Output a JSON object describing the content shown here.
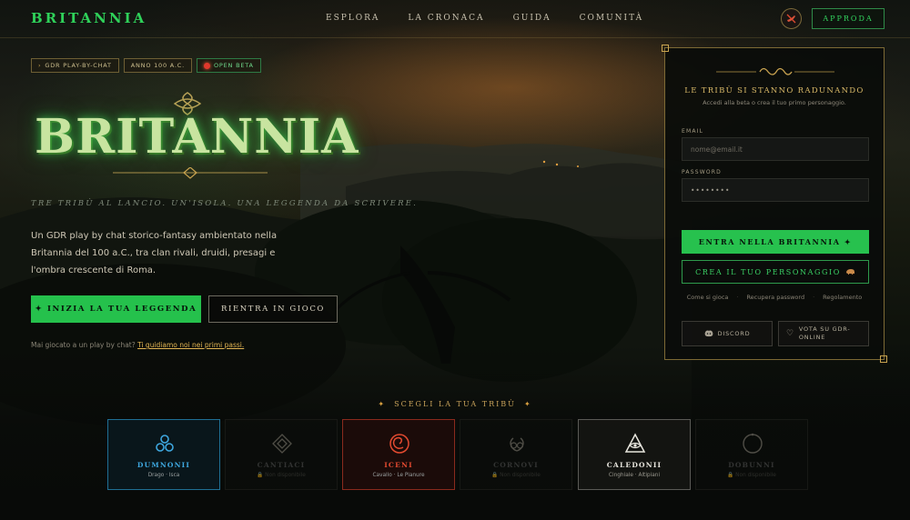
{
  "nav": {
    "brand": "BRITANNIA",
    "links": [
      "ESPLORA",
      "LA CRONACA",
      "GUIDA",
      "COMUNITÀ"
    ],
    "sound_icon": "muted-horn-icon",
    "login_label": "APPRODA"
  },
  "hero": {
    "badges": [
      "GDR PLAY-BY-CHAT",
      "ANNO 100 A.C.",
      "OPEN BETA"
    ],
    "logo_text": "BRITANNIA",
    "tagline": "TRE TRIBÙ AL LANCIO. UN'ISOLA. UNA LEGGENDA DA SCRIVERE.",
    "description": "Un GDR play by chat storico-fantasy ambientato nella Britannia del 100 a.C., tra clan rivali, druidi, presagi e l'ombra crescente di Roma.",
    "cta_primary": "✦ INIZIA LA TUA LEGGENDA",
    "cta_secondary": "RIENTRA IN GIOCO",
    "help_text": "Mai giocato a un play by chat?",
    "help_link": "Ti guidiamo noi nei primi passi."
  },
  "panel": {
    "title": "LE TRIBÙ SI STANNO RADUNANDO",
    "subtitle": "Accedi alla beta o crea il tuo primo personaggio.",
    "email_label": "EMAIL",
    "email_placeholder": "nome@email.it",
    "password_label": "PASSWORD",
    "password_value": "••••••••",
    "enter_label": "ENTRA NELLA BRITANNIA ✦",
    "create_label": "CREA IL TUO PERSONAGGIO",
    "links": [
      "Come si gioca",
      "Recupera password",
      "Regolamento"
    ],
    "discord_label": "DISCORD",
    "vote_label": "VOTA SU GDR-ONLINE"
  },
  "tribes": {
    "title": "SCEGLI LA TUA TRIBÙ",
    "items": [
      {
        "name": "DUMNONII",
        "sub": "Drago · Isca",
        "icon": "triskelion-icon",
        "state": "active-blue"
      },
      {
        "name": "CANTIACI",
        "sub": "🔒 Non disponibile",
        "icon": "diamond-knot-icon",
        "state": "locked"
      },
      {
        "name": "ICENI",
        "sub": "Cavallo · Le Pianure",
        "icon": "spiral-icon",
        "state": "active-red"
      },
      {
        "name": "CORNOVI",
        "sub": "🔒 Non disponibile",
        "icon": "antlers-icon",
        "state": "locked"
      },
      {
        "name": "CALEDONII",
        "sub": "Cinghiale · Altipiani",
        "icon": "triangle-eye-icon",
        "state": "active-white"
      },
      {
        "name": "DOBUNNI",
        "sub": "🔒 Non disponibile",
        "icon": "circle-icon",
        "state": "locked"
      }
    ]
  },
  "colors": {
    "accent_green": "#27c14e",
    "gold": "#c9a350",
    "dumnonii_blue": "#3ea8e0",
    "iceni_red": "#e24a30"
  }
}
